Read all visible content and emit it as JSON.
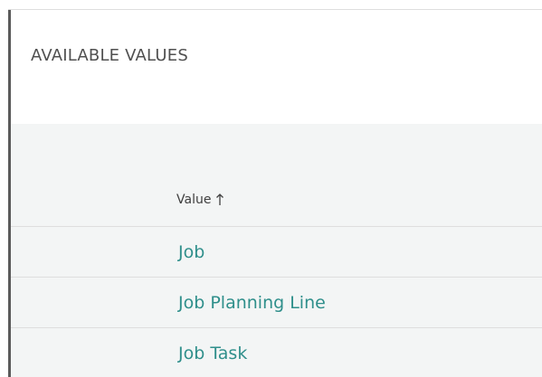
{
  "panel": {
    "title": "AVAILABLE VALUES"
  },
  "table": {
    "header": {
      "label": "Value",
      "sort": "ascending",
      "sort_icon": "arrow-up-icon"
    },
    "rows": [
      {
        "value": "Job"
      },
      {
        "value": "Job Planning Line"
      },
      {
        "value": "Job Task"
      }
    ]
  },
  "colors": {
    "link": "#2f8f8b",
    "header_text": "#3f3f3f",
    "title_text": "#505050",
    "grid_bg": "#f3f5f5",
    "divider": "#dedede"
  }
}
